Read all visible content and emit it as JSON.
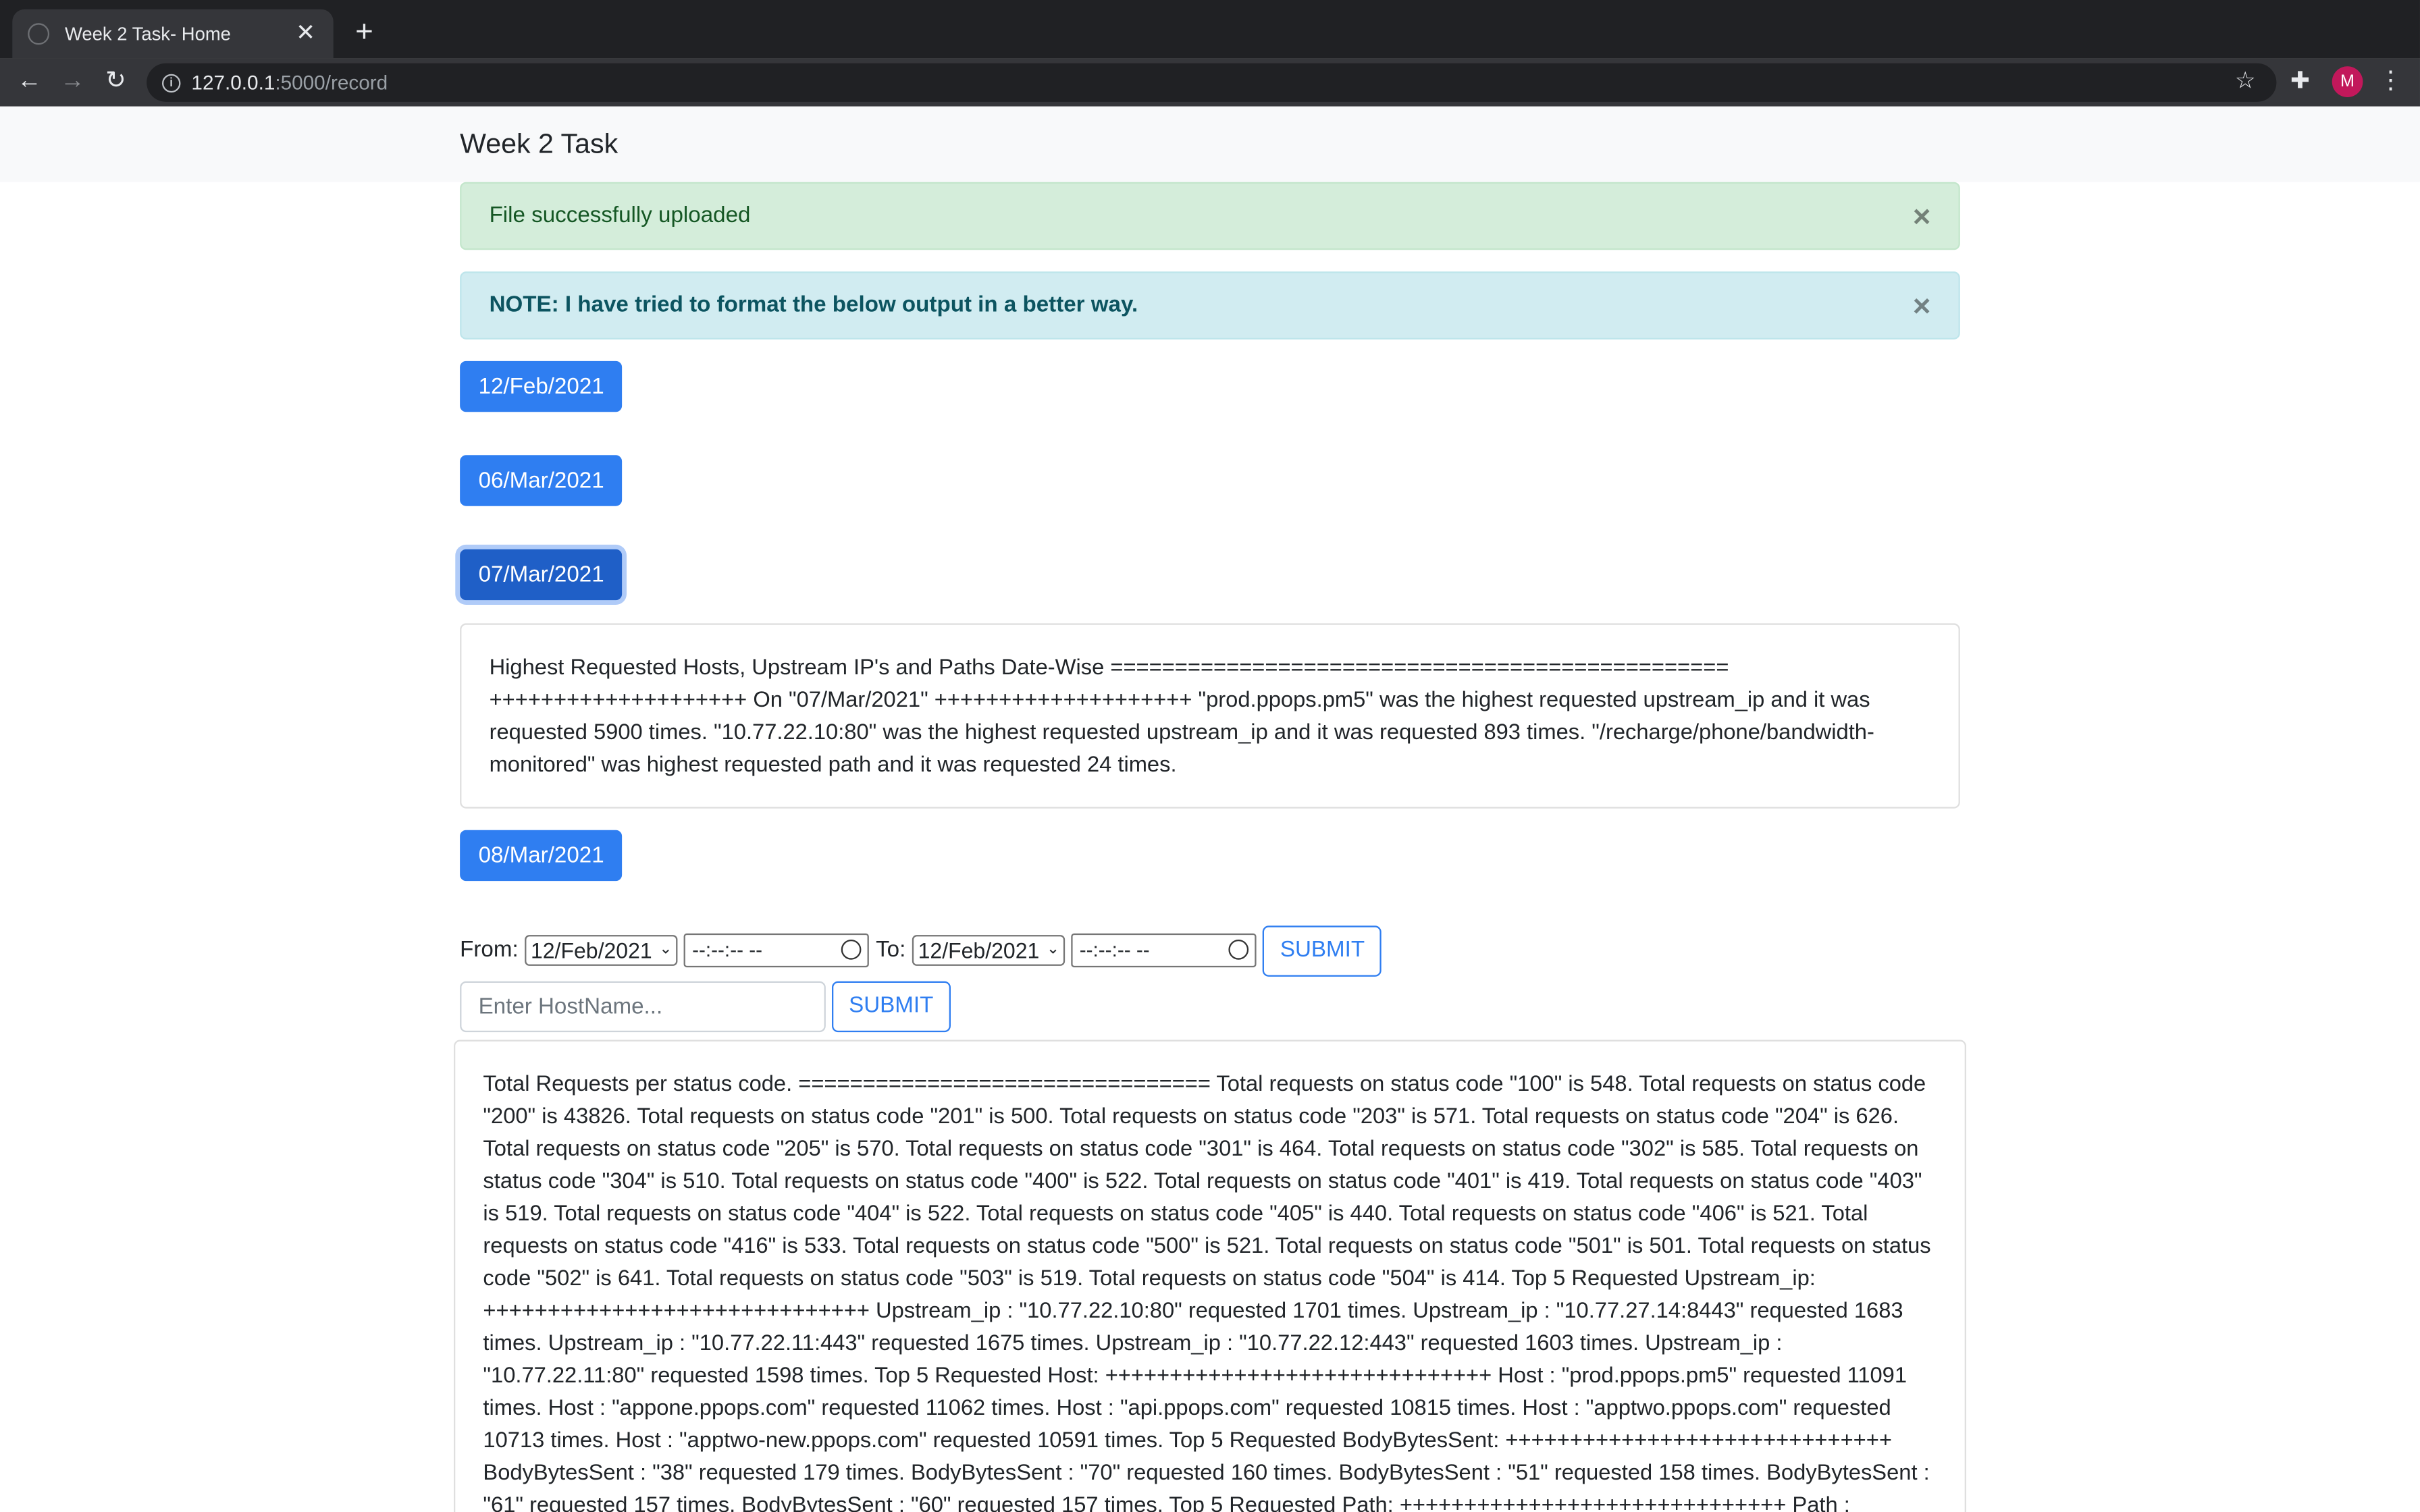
{
  "browser": {
    "tab_title": "Week 2 Task- Home",
    "tab_close": "✕",
    "new_tab": "+",
    "url_host": "127.0.0.1",
    "url_rest": ":5000/record",
    "avatar_letter": "M"
  },
  "navbar": {
    "brand": "Week 2 Task"
  },
  "alerts": {
    "success": "File successfully uploaded",
    "info": "NOTE: I have tried to format the below output in a better way.",
    "close": "×"
  },
  "dates": [
    "12/Feb/2021",
    "06/Mar/2021",
    "07/Mar/2021",
    "08/Mar/2021"
  ],
  "date_card_text": "Highest Requested Hosts, Upstream IP's and Paths Date-Wise ================================================ ++++++++++++++++++++ On \"07/Mar/2021\" ++++++++++++++++++++ \"prod.ppops.pm5\" was the highest requested upstream_ip and it was requested 5900 times. \"10.77.22.10:80\" was the highest requested upstream_ip and it was requested 893 times. \"/recharge/phone/bandwidth-monitored\" was highest requested path and it was requested 24 times.",
  "filter": {
    "from_label": "From:",
    "to_label": "To:",
    "from_date": "12/Feb/2021",
    "to_date": "12/Feb/2021",
    "time_placeholder": "--:--:-- --",
    "submit": "SUBMIT"
  },
  "host_search": {
    "placeholder": "Enter HostName...",
    "submit": "SUBMIT"
  },
  "stats_text": "Total Requests per status code. ================================ Total requests on status code \"100\" is 548. Total requests on status code \"200\" is 43826. Total requests on status code \"201\" is 500. Total requests on status code \"203\" is 571. Total requests on status code \"204\" is 626. Total requests on status code \"205\" is 570. Total requests on status code \"301\" is 464. Total requests on status code \"302\" is 585. Total requests on status code \"304\" is 510. Total requests on status code \"400\" is 522. Total requests on status code \"401\" is 419. Total requests on status code \"403\" is 519. Total requests on status code \"404\" is 522. Total requests on status code \"405\" is 440. Total requests on status code \"406\" is 521. Total requests on status code \"416\" is 533. Total requests on status code \"500\" is 521. Total requests on status code \"501\" is 501. Total requests on status code \"502\" is 641. Total requests on status code \"503\" is 519. Total requests on status code \"504\" is 414. Top 5 Requested Upstream_ip: ++++++++++++++++++++++++++++++ Upstream_ip : \"10.77.22.10:80\" requested 1701 times. Upstream_ip : \"10.77.27.14:8443\" requested 1683 times. Upstream_ip : \"10.77.22.11:443\" requested 1675 times. Upstream_ip : \"10.77.22.12:443\" requested 1603 times. Upstream_ip : \"10.77.22.11:80\" requested 1598 times. Top 5 Requested Host: ++++++++++++++++++++++++++++++ Host : \"prod.ppops.pm5\" requested 11091 times. Host : \"appone.ppops.com\" requested 11062 times. Host : \"api.ppops.com\" requested 10815 times. Host : \"apptwo.ppops.com\" requested 10713 times. Host : \"apptwo-new.ppops.com\" requested 10591 times. Top 5 Requested BodyBytesSent: ++++++++++++++++++++++++++++++ BodyBytesSent : \"38\" requested 179 times. BodyBytesSent : \"70\" requested 160 times. BodyBytesSent : \"51\" requested 158 times. BodyBytesSent : \"61\" requested 157 times. BodyBytesSent : \"60\" requested 157 times. Top 5 Requested Path: ++++++++++++++++++++++++++++++ Path :",
  "colors": {
    "primary": "#2f7ef1",
    "success_bg": "#d4edda",
    "info_bg": "#d1ecf1"
  }
}
